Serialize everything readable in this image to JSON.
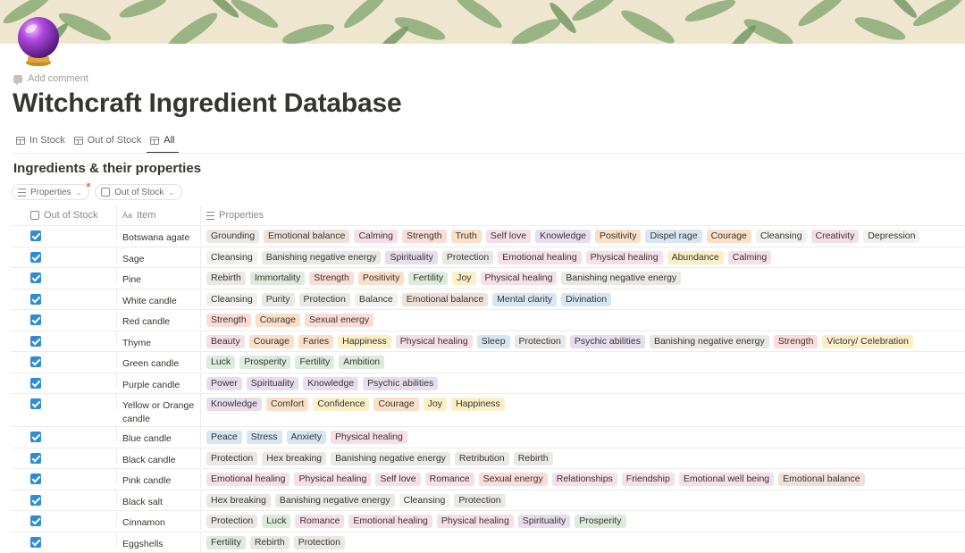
{
  "page": {
    "add_comment": "Add comment",
    "title": "Witchcraft Ingredient Database"
  },
  "views": [
    {
      "label": "In Stock",
      "active": false
    },
    {
      "label": "Out of Stock",
      "active": false
    },
    {
      "label": "All",
      "active": true
    }
  ],
  "database": {
    "title": "Ingredients & their properties",
    "filters": {
      "properties": "Properties",
      "out_of_stock": "Out of Stock"
    },
    "columns": {
      "out_of_stock": "Out of Stock",
      "item": "Item",
      "properties": "Properties"
    },
    "colors": {
      "accent_checkbox": "#2e8bd6",
      "filter_dot": "#e8844a"
    },
    "rows": [
      {
        "item": "Botswana agate",
        "checked": true,
        "tags": [
          [
            "Grounding",
            "gray"
          ],
          [
            "Emotional balance",
            "brown"
          ],
          [
            "Calming",
            "pink"
          ],
          [
            "Strength",
            "red"
          ],
          [
            "Truth",
            "orange"
          ],
          [
            "Self love",
            "pink"
          ],
          [
            "Knowledge",
            "purple"
          ],
          [
            "Positivity",
            "orange"
          ],
          [
            "Dispel rage",
            "blue"
          ],
          [
            "Courage",
            "orange"
          ],
          [
            "Cleansing",
            "default"
          ],
          [
            "Creativity",
            "pink"
          ],
          [
            "Depression",
            "default"
          ]
        ]
      },
      {
        "item": "Sage",
        "checked": true,
        "tags": [
          [
            "Cleansing",
            "default"
          ],
          [
            "Banishing negative energy",
            "gray"
          ],
          [
            "Spirituality",
            "purple"
          ],
          [
            "Protection",
            "gray"
          ],
          [
            "Emotional healing",
            "pink"
          ],
          [
            "Physical healing",
            "pink"
          ],
          [
            "Abundance",
            "yellow"
          ],
          [
            "Calming",
            "pink"
          ]
        ]
      },
      {
        "item": "Pine",
        "checked": true,
        "tags": [
          [
            "Rebirth",
            "gray"
          ],
          [
            "Immortality",
            "green"
          ],
          [
            "Strength",
            "red"
          ],
          [
            "Positivity",
            "orange"
          ],
          [
            "Fertility",
            "green"
          ],
          [
            "Joy",
            "yellow"
          ],
          [
            "Physical healing",
            "pink"
          ],
          [
            "Banishing negative energy",
            "gray"
          ]
        ]
      },
      {
        "item": "White candle",
        "checked": true,
        "tags": [
          [
            "Cleansing",
            "default"
          ],
          [
            "Purity",
            "gray"
          ],
          [
            "Protection",
            "gray"
          ],
          [
            "Balance",
            "default"
          ],
          [
            "Emotional balance",
            "brown"
          ],
          [
            "Mental clarity",
            "blue"
          ],
          [
            "Divination",
            "blue"
          ]
        ]
      },
      {
        "item": "Red candle",
        "checked": true,
        "tags": [
          [
            "Strength",
            "red"
          ],
          [
            "Courage",
            "orange"
          ],
          [
            "Sexual energy",
            "red"
          ]
        ]
      },
      {
        "item": "Thyme",
        "checked": true,
        "tags": [
          [
            "Beauty",
            "pink"
          ],
          [
            "Courage",
            "orange"
          ],
          [
            "Faries",
            "orange"
          ],
          [
            "Happiness",
            "yellow"
          ],
          [
            "Physical healing",
            "pink"
          ],
          [
            "Sleep",
            "blue"
          ],
          [
            "Protection",
            "gray"
          ],
          [
            "Psychic abilities",
            "purple"
          ],
          [
            "Banishing negative energy",
            "gray"
          ],
          [
            "Strength",
            "red"
          ],
          [
            "Victory/ Celebration",
            "yellow"
          ]
        ]
      },
      {
        "item": "Green candle",
        "checked": true,
        "tags": [
          [
            "Luck",
            "green"
          ],
          [
            "Prosperity",
            "green"
          ],
          [
            "Fertility",
            "green"
          ],
          [
            "Ambition",
            "green"
          ]
        ]
      },
      {
        "item": "Purple candle",
        "checked": true,
        "tags": [
          [
            "Power",
            "purple"
          ],
          [
            "Spirituality",
            "purple"
          ],
          [
            "Knowledge",
            "purple"
          ],
          [
            "Psychic abilities",
            "purple"
          ]
        ]
      },
      {
        "item": "Yellow or Orange candle",
        "checked": true,
        "tall": true,
        "tags": [
          [
            "Knowledge",
            "purple"
          ],
          [
            "Comfort",
            "orange"
          ],
          [
            "Confidence",
            "yellow"
          ],
          [
            "Courage",
            "orange"
          ],
          [
            "Joy",
            "yellow"
          ],
          [
            "Happiness",
            "yellow"
          ]
        ]
      },
      {
        "item": "Blue candle",
        "checked": true,
        "tags": [
          [
            "Peace",
            "blue"
          ],
          [
            "Stress",
            "blue"
          ],
          [
            "Anxiety",
            "blue"
          ],
          [
            "Physical healing",
            "pink"
          ]
        ]
      },
      {
        "item": "Black candle",
        "checked": true,
        "tags": [
          [
            "Protection",
            "gray"
          ],
          [
            "Hex breaking",
            "gray"
          ],
          [
            "Banishing negative energy",
            "gray"
          ],
          [
            "Retribution",
            "gray"
          ],
          [
            "Rebirth",
            "gray"
          ]
        ]
      },
      {
        "item": "Pink candle",
        "checked": true,
        "tags": [
          [
            "Emotional healing",
            "pink"
          ],
          [
            "Physical healing",
            "pink"
          ],
          [
            "Self love",
            "pink"
          ],
          [
            "Romance",
            "pink"
          ],
          [
            "Sexual energy",
            "red"
          ],
          [
            "Relationships",
            "pink"
          ],
          [
            "Friendship",
            "pink"
          ],
          [
            "Emotional well being",
            "pink"
          ],
          [
            "Emotional balance",
            "brown"
          ]
        ]
      },
      {
        "item": "Black salt",
        "checked": true,
        "tags": [
          [
            "Hex breaking",
            "gray"
          ],
          [
            "Banishing negative energy",
            "gray"
          ],
          [
            "Cleansing",
            "default"
          ],
          [
            "Protection",
            "gray"
          ]
        ]
      },
      {
        "item": "Cinnamon",
        "checked": true,
        "tags": [
          [
            "Protection",
            "gray"
          ],
          [
            "Luck",
            "green"
          ],
          [
            "Romance",
            "pink"
          ],
          [
            "Emotional healing",
            "pink"
          ],
          [
            "Physical healing",
            "pink"
          ],
          [
            "Spirituality",
            "purple"
          ],
          [
            "Prosperity",
            "green"
          ]
        ]
      },
      {
        "item": "Eggshells",
        "checked": true,
        "tags": [
          [
            "Fertility",
            "green"
          ],
          [
            "Rebirth",
            "gray"
          ],
          [
            "Protection",
            "gray"
          ]
        ]
      }
    ]
  }
}
